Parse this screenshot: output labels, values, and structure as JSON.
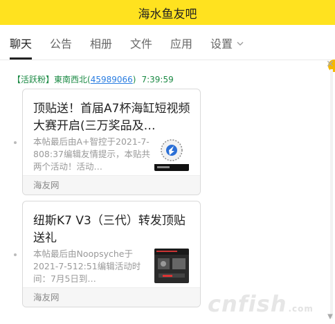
{
  "window": {
    "title": "海水鱼友吧"
  },
  "tabs": [
    {
      "label": "聊天",
      "active": true
    },
    {
      "label": "公告"
    },
    {
      "label": "相册"
    },
    {
      "label": "文件"
    },
    {
      "label": "应用"
    },
    {
      "label": "设置"
    }
  ],
  "message": {
    "badge": "【活跃粉】",
    "sender": "東南西北",
    "uid_open": "(",
    "uid": "45989066",
    "uid_close": ")",
    "time": "7:39:59"
  },
  "cards": [
    {
      "title": "顶贴送！首届A7杯海缸短视频大赛开启(三万奖品及…",
      "desc": "本帖最后由A+智控于2021-7-808:37编辑友情提示，本贴共两个活动！活动…",
      "source": "海友网",
      "thumb_icon": "contest-poster-thumbnail"
    },
    {
      "title": "纽斯K7 V3（三代）转发顶贴送礼",
      "desc": "本帖最后由Noopsyche于2021-7-512:51编辑活动时间：7月5日到…",
      "source": "海友网",
      "thumb_icon": "product-photo-thumbnail"
    }
  ],
  "watermark": {
    "text": "cnfish",
    "suffix": ".com"
  },
  "colors": {
    "titlebar": "#ffe21f",
    "sender": "#1b8a44",
    "link": "#2a7de1"
  }
}
